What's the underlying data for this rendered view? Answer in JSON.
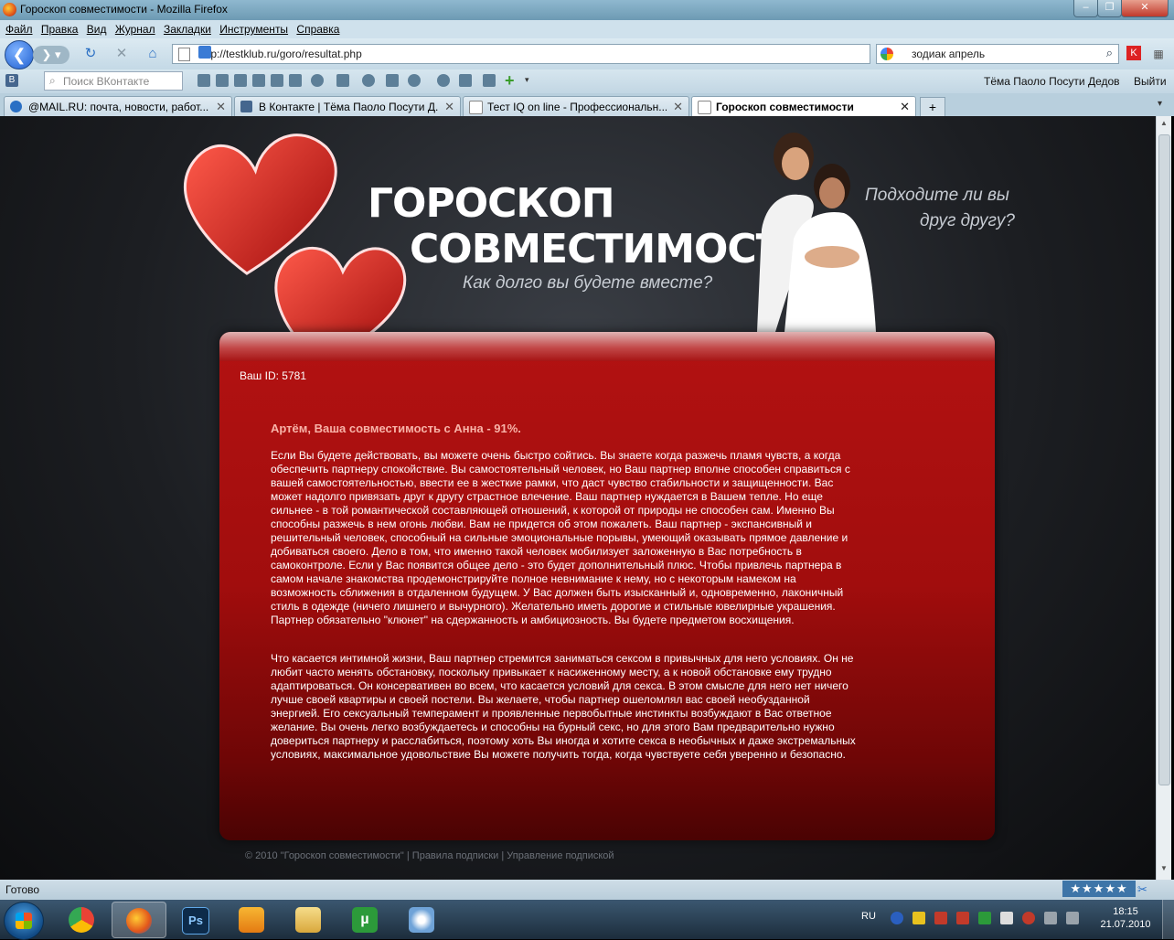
{
  "window": {
    "title": "Гороскоп совместимости - Mozilla Firefox"
  },
  "menu": [
    "Файл",
    "Правка",
    "Вид",
    "Журнал",
    "Закладки",
    "Инструменты",
    "Справка"
  ],
  "nav": {
    "url": "http://testklub.ru/goro/resultat.php",
    "search_value": "зодиак апрель"
  },
  "vk_toolbar": {
    "search_placeholder": "Поиск ВКонтакте",
    "user_name": "Тёма Паоло Посути Дедов",
    "logout": "Выйти"
  },
  "tabs": [
    {
      "label": "@MAIL.RU: почта, новости, работ...",
      "icon": "mailru-icon"
    },
    {
      "label": "В Контакте | Тёма Паоло Посути Д...",
      "icon": "vk-icon"
    },
    {
      "label": "Тест IQ on line - Профессиональн...",
      "icon": "page-icon"
    },
    {
      "label": "Гороскоп совместимости",
      "icon": "page-icon",
      "active": true
    }
  ],
  "site": {
    "title_line1": "ГОРОСКОП",
    "title_line2": "СОВМЕСТИМОСТИ",
    "tagline": "Как долго вы будете вместе?",
    "question_line1": "Подходите ли вы",
    "question_line2": "друг другу?"
  },
  "result": {
    "user_id": "Ваш ID: 5781",
    "title": "Артём, Ваша совместимость с Анна - 91%.",
    "paragraph1": "Если Вы будете действовать, вы можете очень быстро сойтись. Вы знаете когда разжечь пламя чувств, а когда обеспечить партнеру спокойствие. Вы самостоятельный человек, но Ваш партнер вполне способен справиться с вашей самостоятельностью, ввести ее в жесткие рамки, что даст чувство стабильности и защищенности. Вас может надолго привязать друг к другу страстное влечение. Ваш партнер нуждается в Вашем тепле. Но еще сильнее - в той романтической составляющей отношений, к которой от природы не способен сам. Именно Вы способны разжечь в нем огонь любви. Вам не придется об этом пожалеть. Ваш партнер - экспансивный и решительный человек, способный на сильные эмоциональные порывы, умеющий оказывать прямое давление и добиваться своего. Дело в том, что именно такой человек мобилизует заложенную в Вас потребность в самоконтроле. Если у Вас появится общее дело - это будет дополнительный плюс. Чтобы привлечь партнера в самом начале знакомства продемонстрируйте полное невнимание к нему, но с некоторым намеком на возможность сближения в отдаленном будущем. У Вас должен быть изысканный и, одновременно, лаконичный стиль в одежде (ничего лишнего и вычурного). Желательно иметь дорогие и стильные ювелирные украшения. Партнер обязательно \"клюнет\" на сдержанность и амбициозность. Вы будете предметом восхищения.",
    "paragraph2": "Что касается интимной жизни, Ваш партнер стремится заниматься сексом в привычных для него условиях. Он не любит часто менять обстановку, поскольку привыкает к насиженному месту, а к новой обстановке ему трудно адаптироваться. Он консервативен во всем, что касается условий для секса. В этом смысле для него нет ничего лучше своей квартиры и своей постели. Вы желаете, чтобы партнер ошеломлял вас своей необузданной энергией. Его сексуальный темперамент и проявленные первобытные инстинкты возбуждают в Вас ответное желание. Вы очень легко возбуждаетесь и способны на бурный секс, но для этого Вам предварительно нужно довериться партнеру и расслабиться, поэтому хоть Вы иногда и хотите секса в необычных и даже экстремальных условиях, максимальное удовольствие Вы можете получить тогда, когда чувствуете себя уверенно и безопасно."
  },
  "footer": "© 2010 \"Гороскоп совместимости\" | Правила подписки | Управление подпиской",
  "status": {
    "text": "Готово",
    "rating": "★★★★★"
  },
  "taskbar": {
    "lang": "RU",
    "time": "18:15",
    "date": "21.07.2010",
    "apps": [
      "chrome-icon",
      "firefox-icon",
      "photoshop-icon",
      "media-player-icon",
      "explorer-icon",
      "utorrent-icon",
      "paint-icon"
    ]
  },
  "colors": {
    "panel_red": "#b31212",
    "result_title": "#f8b3a8",
    "chrome_blue": "#c4d9e6"
  }
}
